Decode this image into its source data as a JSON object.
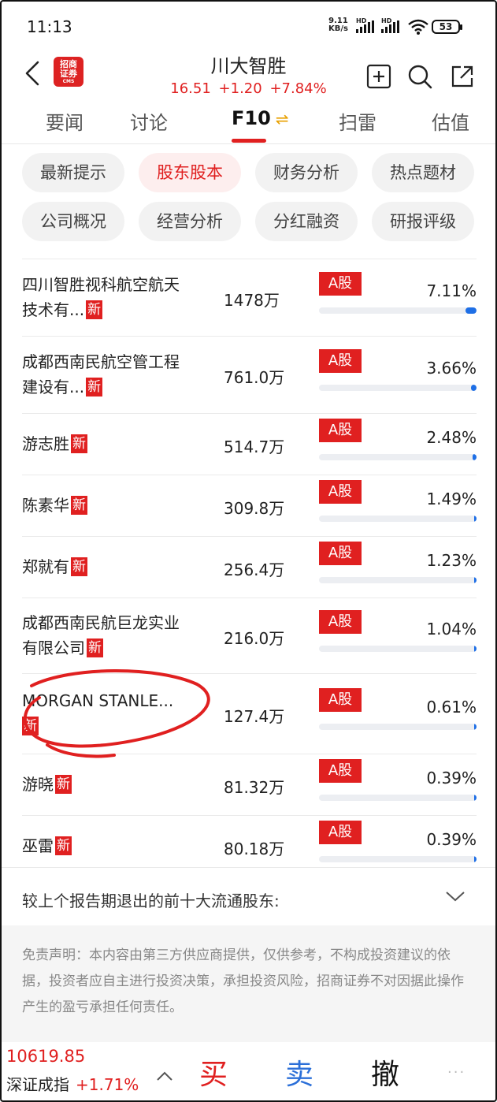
{
  "status_bar": {
    "time": "11:13",
    "net_speed_value": "9.11",
    "net_speed_unit": "KB/s",
    "hd1": "HD",
    "hd2": "HD",
    "battery": "53"
  },
  "header": {
    "logo_line1": "招商",
    "logo_line2": "证券",
    "logo_sub": "CMS",
    "stock_name": "川大智胜",
    "price": "16.51",
    "change": "+1.20",
    "change_pct": "+7.84%"
  },
  "tabs": [
    {
      "label": "要闻"
    },
    {
      "label": "讨论"
    },
    {
      "label": "F10",
      "icon": "swap-icon",
      "swap_glyph": "⇌"
    },
    {
      "label": "扫雷"
    },
    {
      "label": "估值"
    }
  ],
  "chips": [
    {
      "label": "最新提示",
      "active": false
    },
    {
      "label": "股东股本",
      "active": true
    },
    {
      "label": "财务分析",
      "active": false
    },
    {
      "label": "热点题材",
      "active": false
    },
    {
      "label": "公司概况",
      "active": false
    },
    {
      "label": "经营分析",
      "active": false
    },
    {
      "label": "分红融资",
      "active": false
    },
    {
      "label": "研报评级",
      "active": false
    }
  ],
  "holders": [
    {
      "name_line1": "四川智胜视科航空航天",
      "name_line2": "技术有...",
      "badge": "新",
      "shares": "1478万",
      "type": "A股",
      "pct": "7.11%",
      "ratio": 0.0711
    },
    {
      "name_line1": "成都西南民航空管工程",
      "name_line2": "建设有...",
      "badge": "新",
      "shares": "761.0万",
      "type": "A股",
      "pct": "3.66%",
      "ratio": 0.0366
    },
    {
      "name_line1": "游志胜",
      "name_line2": "",
      "badge": "新",
      "shares": "514.7万",
      "type": "A股",
      "pct": "2.48%",
      "ratio": 0.0248
    },
    {
      "name_line1": "陈素华",
      "name_line2": "",
      "badge": "新",
      "shares": "309.8万",
      "type": "A股",
      "pct": "1.49%",
      "ratio": 0.0149
    },
    {
      "name_line1": "郑就有",
      "name_line2": "",
      "badge": "新",
      "shares": "256.4万",
      "type": "A股",
      "pct": "1.23%",
      "ratio": 0.0123
    },
    {
      "name_line1": "成都西南民航巨龙实业",
      "name_line2": "有限公司",
      "badge": "新",
      "shares": "216.0万",
      "type": "A股",
      "pct": "1.04%",
      "ratio": 0.0104
    },
    {
      "name_line1": "MORGAN STANLE...",
      "name_line2": "",
      "badge": "新",
      "shares": "127.4万",
      "type": "A股",
      "pct": "0.61%",
      "ratio": 0.0061
    },
    {
      "name_line1": "游晓",
      "name_line2": "",
      "badge": "新",
      "shares": "81.32万",
      "type": "A股",
      "pct": "0.39%",
      "ratio": 0.0039
    },
    {
      "name_line1": "巫雷",
      "name_line2": "",
      "badge": "新",
      "shares": "80.18万",
      "type": "A股",
      "pct": "0.39%",
      "ratio": 0.0039
    }
  ],
  "exited_label": "较上个报告期退出的前十大流通股东:",
  "disclaimer": "免责声明：本内容由第三方供应商提供，仅供参考，不构成投资建议的依据，投资者应自主进行投资决策，承担投资风险，招商证券不对因据此操作产生的盈亏承担任何责任。",
  "bottom_bar": {
    "index_value": "10619.85",
    "index_name": "深证成指",
    "index_change": "+1.71%",
    "buy": "买",
    "sell": "卖",
    "cancel": "撤",
    "more": "···"
  },
  "colors": {
    "accent_red": "#e02020",
    "bar_blue": "#1e6fe6",
    "sell_blue": "#2b6fd8",
    "swap_orange": "#e8a000"
  }
}
